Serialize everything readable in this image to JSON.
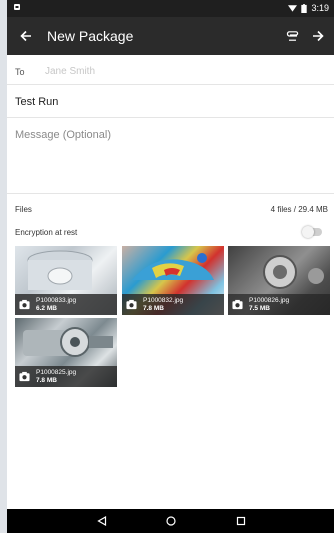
{
  "status_bar": {
    "time": "3:19"
  },
  "app_bar": {
    "title": "New Package"
  },
  "to": {
    "label": "To",
    "value": "Jane Smith"
  },
  "subject": {
    "value": "Test Run"
  },
  "message": {
    "placeholder": "Message (Optional)"
  },
  "files": {
    "label": "Files",
    "count": "4 files / 29.4 MB"
  },
  "encryption": {
    "label": "Encryption at rest",
    "enabled": false
  },
  "attachments": [
    {
      "name": "P1000833.jpg",
      "size": "6.2 MB"
    },
    {
      "name": "P1000832.jpg",
      "size": "7.8 MB"
    },
    {
      "name": "P1000826.jpg",
      "size": "7.5 MB"
    },
    {
      "name": "P1000825.jpg",
      "size": "7.8 MB"
    }
  ],
  "icons": {
    "back": "arrow-left-icon",
    "attach": "paperclip-icon",
    "send": "arrow-right-icon",
    "camera": "camera-icon",
    "nav_back": "triangle-back-icon",
    "nav_home": "circle-home-icon",
    "nav_recents": "square-recents-icon"
  },
  "colors": {
    "app_bar": "#2b2b2b",
    "status_bar": "#1f1f1f",
    "nav_bar": "#000000"
  }
}
